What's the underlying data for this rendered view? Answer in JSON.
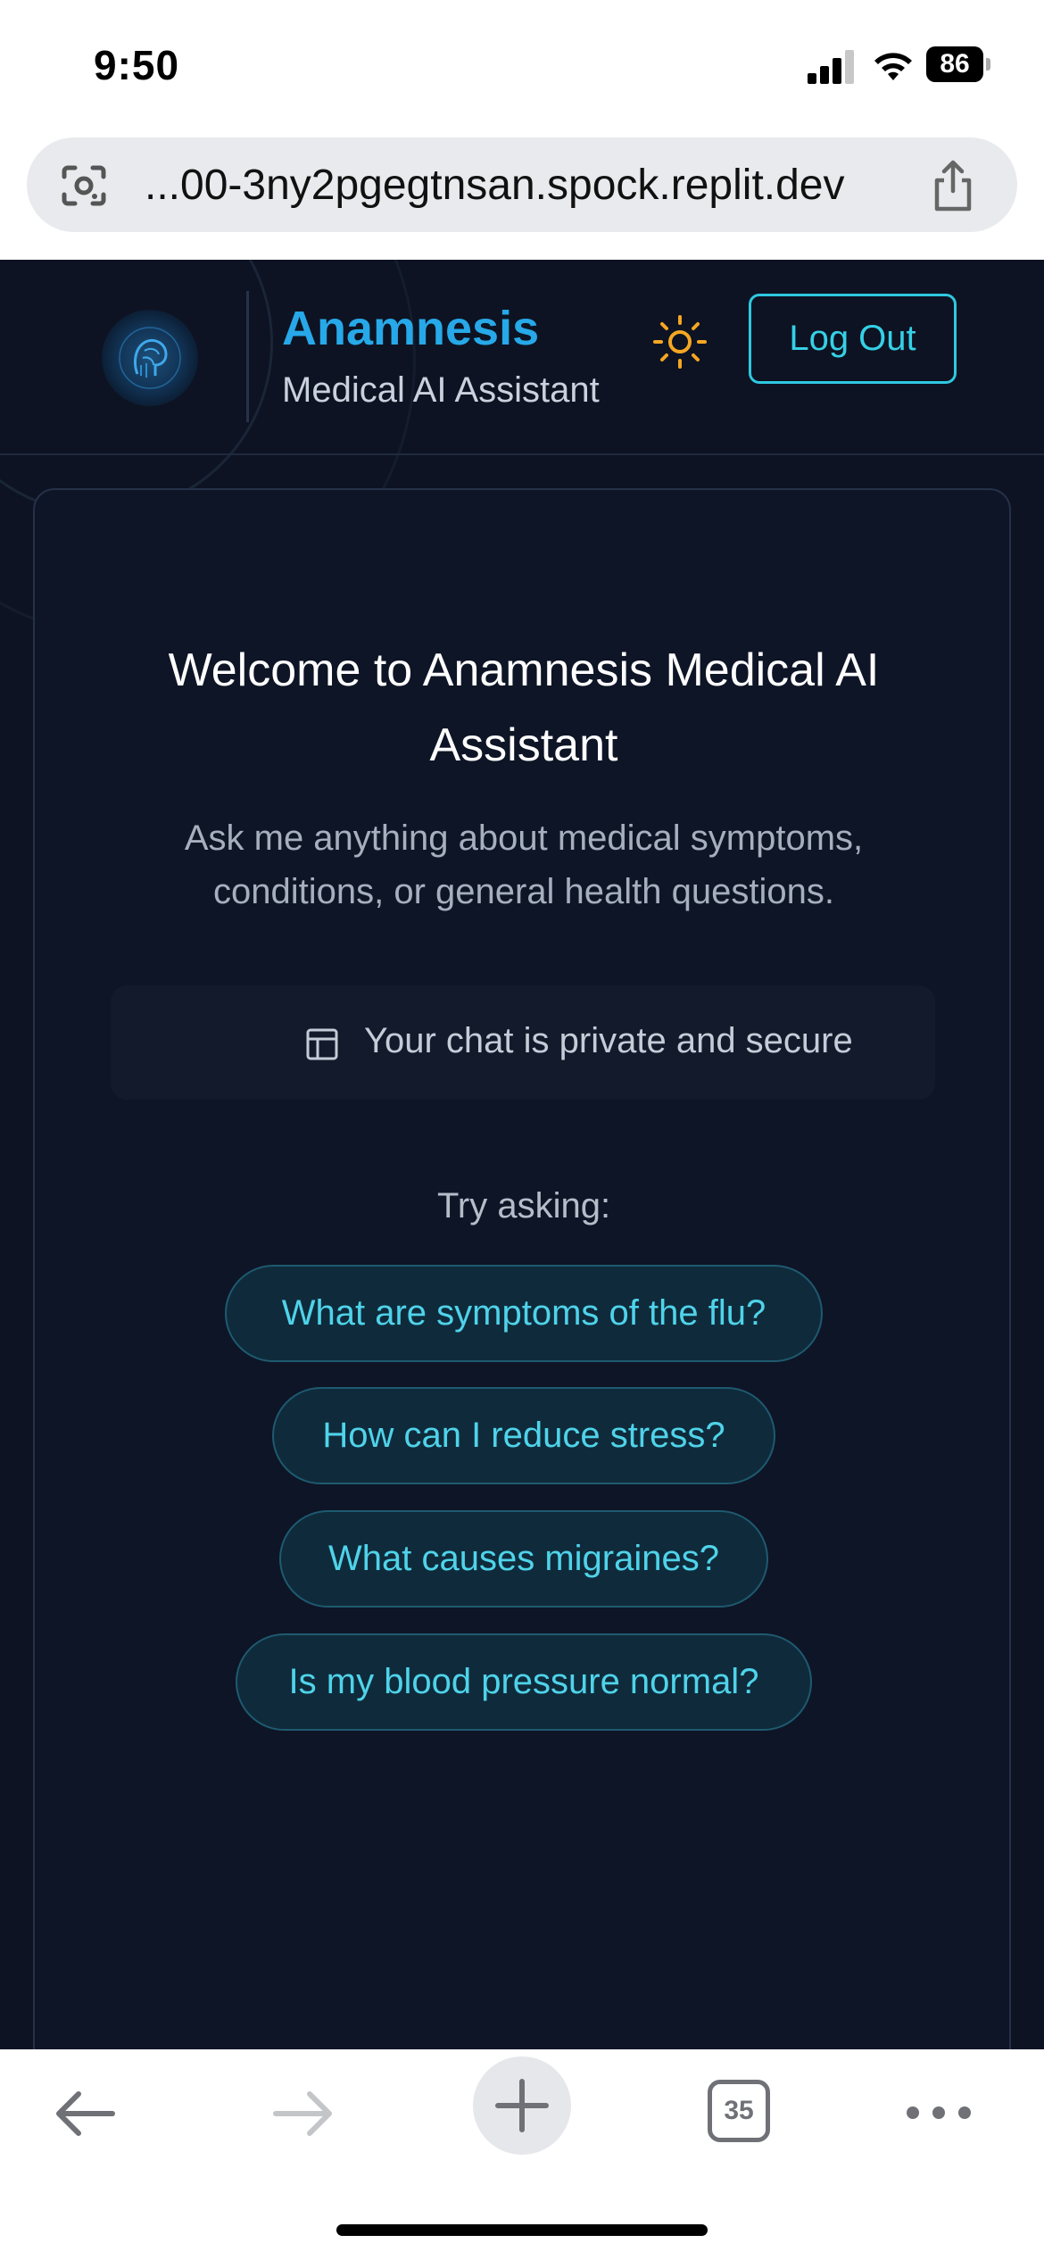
{
  "status_bar": {
    "time": "9:50",
    "battery": "86"
  },
  "browser": {
    "url": "...00-3ny2pgegtnsan.spock.replit.dev",
    "tab_count": "35"
  },
  "header": {
    "title": "Anamnesis",
    "subtitle": "Medical AI Assistant",
    "logout_label": "Log Out"
  },
  "welcome": {
    "heading_line1": "Welcome to Anamnesis Medical AI",
    "heading_line2": "Assistant",
    "description_line1": "Ask me anything about medical symptoms,",
    "description_line2": "conditions, or general health questions.",
    "privacy_note": "Your chat is private and secure",
    "try_label": "Try asking:",
    "suggestions": [
      "What are symptoms of the flu?",
      "How can I reduce stress?",
      "What causes migraines?",
      "Is my blood pressure normal?"
    ]
  },
  "colors": {
    "accent": "#2fc8e0",
    "brand": "#27a8e8",
    "background": "#0d1322",
    "sun": "#f5a623"
  },
  "icons": [
    "lens-icon",
    "share-icon",
    "brain-logo-icon",
    "sun-icon",
    "layout-icon",
    "back-arrow-icon",
    "forward-arrow-icon",
    "plus-icon",
    "more-icon"
  ]
}
